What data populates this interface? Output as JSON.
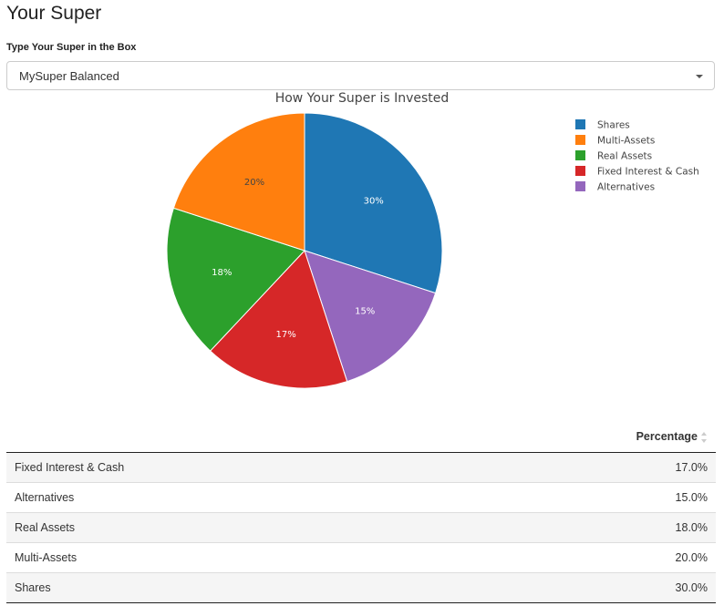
{
  "page": {
    "title": "Your Super"
  },
  "selector": {
    "label": "Type Your Super in the Box",
    "value": "MySuper Balanced"
  },
  "chart_data": {
    "type": "pie",
    "title": "How Your Super is Invested",
    "legend_placement": "top-right",
    "slices": [
      {
        "name": "Shares",
        "value": 30,
        "label": "30%",
        "color": "#1f77b4",
        "label_color": "#ffffff"
      },
      {
        "name": "Alternatives",
        "value": 15,
        "label": "15%",
        "color": "#9467bd",
        "label_color": "#ffffff"
      },
      {
        "name": "Fixed Interest & Cash",
        "value": 17,
        "label": "17%",
        "color": "#d62728",
        "label_color": "#ffffff"
      },
      {
        "name": "Real Assets",
        "value": 18,
        "label": "18%",
        "color": "#2ca02c",
        "label_color": "#ffffff"
      },
      {
        "name": "Multi-Assets",
        "value": 20,
        "label": "20%",
        "color": "#ff7f0e",
        "label_color": "#444444"
      }
    ],
    "legend": [
      "Shares",
      "Multi-Assets",
      "Real Assets",
      "Fixed Interest & Cash",
      "Alternatives"
    ]
  },
  "table": {
    "columns": [
      "",
      "Percentage"
    ],
    "rows": [
      {
        "name": "Fixed Interest & Cash",
        "percentage": "17.0%"
      },
      {
        "name": "Alternatives",
        "percentage": "15.0%"
      },
      {
        "name": "Real Assets",
        "percentage": "18.0%"
      },
      {
        "name": "Multi-Assets",
        "percentage": "20.0%"
      },
      {
        "name": "Shares",
        "percentage": "30.0%"
      }
    ]
  },
  "icons": {
    "select_caret": "caret-down-icon",
    "sort": "sort-icon"
  }
}
